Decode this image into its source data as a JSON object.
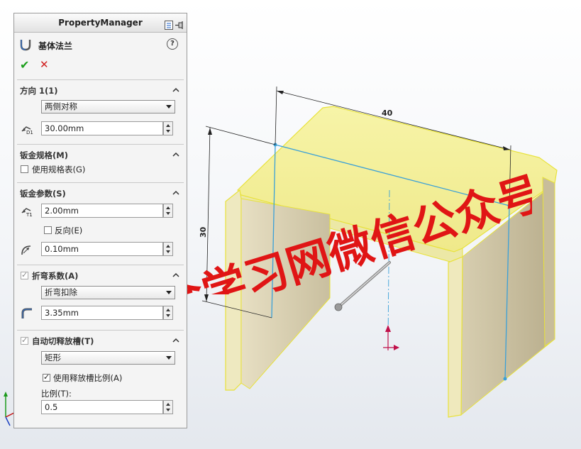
{
  "panel": {
    "title": "PropertyManager",
    "feature_title": "基体法兰",
    "help_label": "?",
    "ok_label": "✔",
    "cancel_label": "✕"
  },
  "direction1": {
    "header": "方向 1(1)",
    "end_condition": "两侧对称",
    "depth": "30.00mm"
  },
  "gauge": {
    "header": "钣金规格(M)",
    "use_gauge_table": "使用规格表(G)",
    "use_gauge_table_checked": false
  },
  "sheet_params": {
    "header": "钣金参数(S)",
    "thickness": "2.00mm",
    "reverse_label": "反向(E)",
    "reverse_checked": false,
    "radius": "0.10mm"
  },
  "bend_allowance": {
    "header": "折弯系数(A)",
    "checked": true,
    "type": "折弯扣除",
    "value": "3.35mm"
  },
  "auto_relief": {
    "header": "自动切释放槽(T)",
    "checked": true,
    "type": "矩形",
    "use_ratio_label": "使用释放槽比例(A)",
    "use_ratio_checked": true,
    "ratio_label": "比例(T):",
    "ratio_value": "0.5"
  },
  "model": {
    "dim_width": "40",
    "dim_height": "30",
    "highlight_color": "#f4f25a",
    "body_color": "#cbc1a2",
    "sketch_color": "#3aa0d8"
  },
  "watermark": {
    "text": "钣金学习网微信公众号",
    "color": "#e01515"
  }
}
